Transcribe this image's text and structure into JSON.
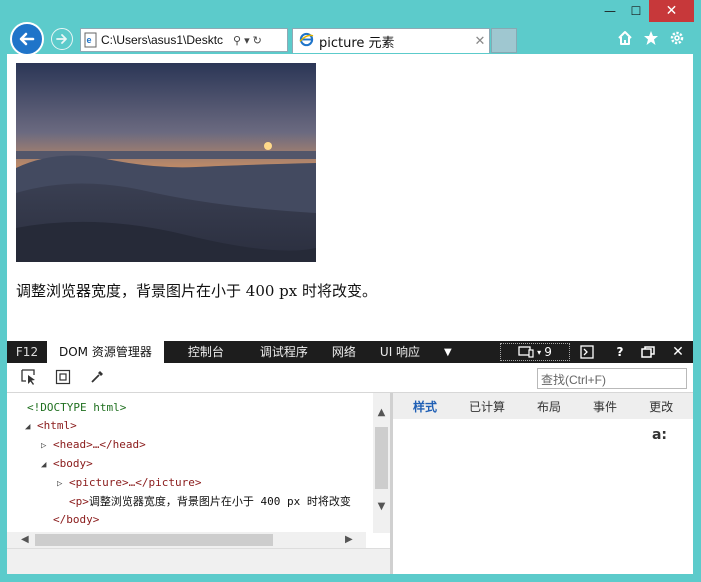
{
  "window": {
    "min_glyph": "—",
    "max_glyph": "☐",
    "close_glyph": "✕"
  },
  "toolbar": {
    "address_text": "C:\\Users\\asus1\\Desktc",
    "search_glyph": "⚲",
    "dropdown_glyph": "▾",
    "refresh_glyph": "↻",
    "tab_title": "picture 元素",
    "tab_close": "✕",
    "icons": [
      "home-icon",
      "favorites-star-icon",
      "settings-gear-icon"
    ]
  },
  "page": {
    "paragraph": "调整浏览器宽度，背景图片在小于 400 px 时将改变。"
  },
  "devtools": {
    "f12_label": "F12",
    "tabs": [
      {
        "label": "DOM 资源管理器",
        "active": true
      },
      {
        "label": "控制台",
        "active": false
      },
      {
        "label": "调试程序",
        "active": false
      },
      {
        "label": "网络",
        "active": false
      },
      {
        "label": "UI 响应",
        "active": false
      }
    ],
    "emulation_value": "9",
    "help_label": "?",
    "find_placeholder": "查找(Ctrl+F)",
    "dom_lines": [
      {
        "text": "<!DOCTYPE html>",
        "toggle": ""
      },
      {
        "text": "<html>",
        "toggle": "◢"
      },
      {
        "text": "<head>…</head>",
        "toggle": "▷"
      },
      {
        "text": "<body>",
        "toggle": "◢"
      },
      {
        "text": "<picture>…</picture>",
        "toggle": "▷"
      },
      {
        "text_tag_open": "<p>",
        "text_body": "调整浏览器宽度，背景图片在小于 400 px 时将改变",
        "toggle": ""
      },
      {
        "text": "</body>",
        "toggle": ""
      }
    ],
    "style_tabs": [
      {
        "label": "样式",
        "active": true
      },
      {
        "label": "已计算",
        "active": false
      },
      {
        "label": "布局",
        "active": false
      },
      {
        "label": "事件",
        "active": false
      },
      {
        "label": "更改",
        "active": false
      }
    ],
    "aa_label": "a:"
  },
  "colors": {
    "window_frame": "#5ccbcb",
    "close_button": "#c7383a",
    "back_button": "#1f74c9",
    "devtools_bar": "#1d1d1d",
    "active_style_tab": "#1f5fb5"
  }
}
